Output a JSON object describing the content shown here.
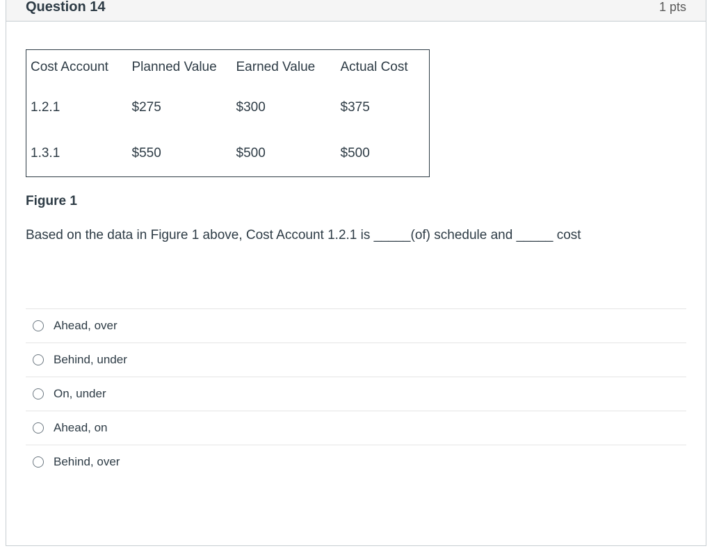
{
  "header": {
    "title": "Question 14",
    "points": "1 pts"
  },
  "table": {
    "headers": [
      "Cost Account",
      "Planned Value",
      "Earned Value",
      "Actual Cost"
    ],
    "rows": [
      [
        "1.2.1",
        "$275",
        "$300",
        "$375"
      ],
      [
        "1.3.1",
        "$550",
        "$500",
        "$500"
      ]
    ]
  },
  "figure_label": "Figure 1",
  "prompt": "Based on the data in Figure 1 above, Cost Account 1.2.1 is _____(of) schedule and _____ cost",
  "options": [
    "Ahead, over",
    "Behind, under",
    "On, under",
    "Ahead, on",
    "Behind, over"
  ]
}
